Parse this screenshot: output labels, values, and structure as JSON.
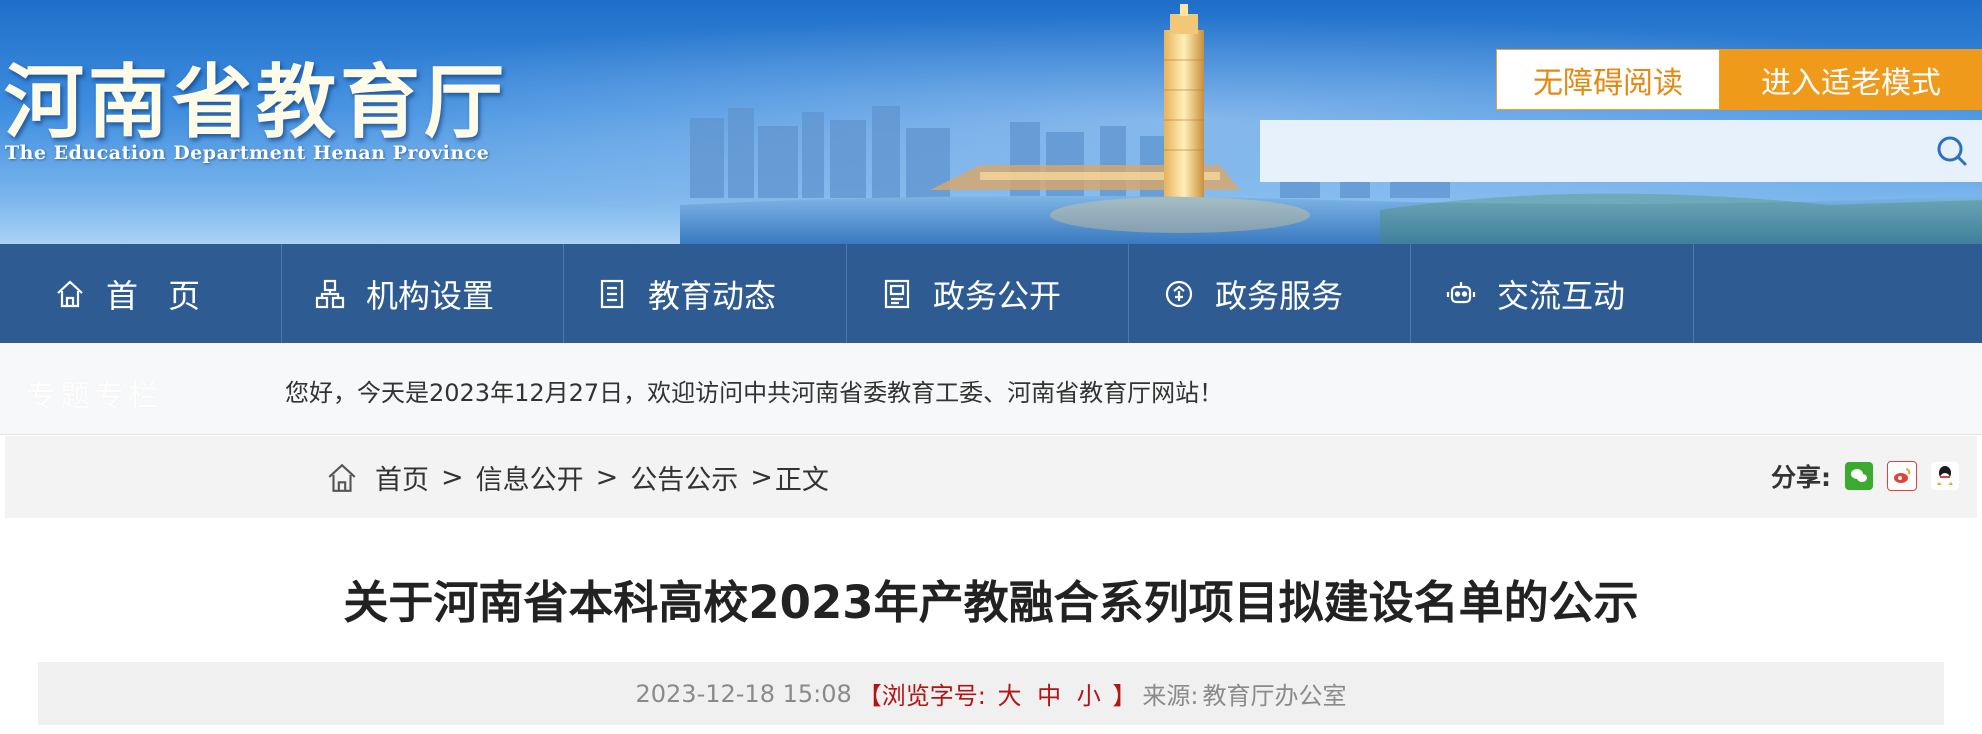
{
  "header": {
    "logo_cn": "河南省教育厅",
    "logo_en": "The Education Department Henan Province",
    "accessibility_label": "无障碍阅读",
    "elder_mode_label": "进入适老模式",
    "search_placeholder": ""
  },
  "nav": {
    "items": [
      {
        "label": "首 页",
        "icon": "home-icon"
      },
      {
        "label": "机构设置",
        "icon": "org-chart-icon"
      },
      {
        "label": "教育动态",
        "icon": "document-list-icon"
      },
      {
        "label": "政务公开",
        "icon": "notice-board-icon"
      },
      {
        "label": "政务服务",
        "icon": "service-badge-icon"
      },
      {
        "label": "交流互动",
        "icon": "chat-bot-icon"
      }
    ]
  },
  "welcome": {
    "faded_text": "专题专栏",
    "message": "您好，今天是2023年12月27日，欢迎访问中共河南省委教育工委、河南省教育厅网站！"
  },
  "breadcrumb": {
    "items": [
      "首页",
      "信息公开",
      "公告公示",
      "正文"
    ]
  },
  "share": {
    "label": "分享:",
    "icons": [
      "wechat-icon",
      "weibo-icon",
      "qq-icon"
    ],
    "colors": {
      "wechat": "#3aab2f",
      "weibo": "#e0433b",
      "qq": "#1a1a1a"
    }
  },
  "article": {
    "title": "关于河南省本科高校2023年产教融合系列项目拟建设名单的公示",
    "datetime": "2023-12-18 15:08",
    "font_size_open": "【浏览字号:",
    "font_size_large": "大",
    "font_size_medium": "中",
    "font_size_small": "小",
    "font_size_close": "】",
    "source_label": "来源:",
    "source": "教育厅办公室"
  },
  "colors": {
    "nav_bg": "#2f5b93",
    "accent_orange": "#f09a1c",
    "title_red": "#b11515"
  }
}
